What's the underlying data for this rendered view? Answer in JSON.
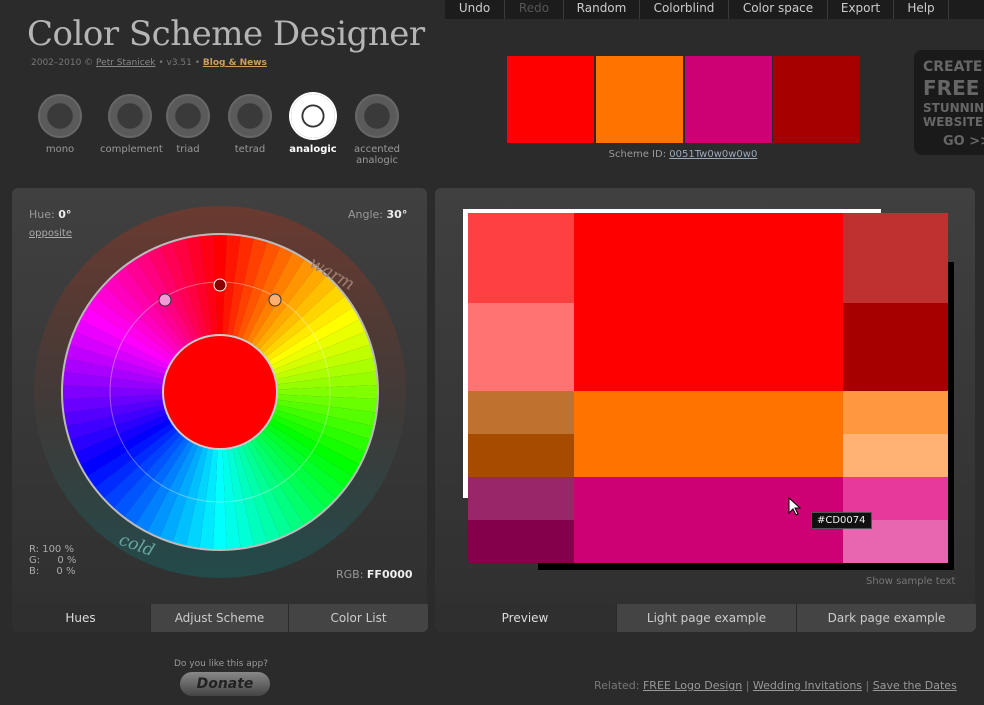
{
  "app": {
    "title": "Color Scheme Designer",
    "subline_prefix": "2002–2010 ©",
    "author": "Petr Stanicek",
    "version": "• v3.51 •",
    "blog": "Blog & News"
  },
  "menu": [
    {
      "label": "Undo",
      "enabled": true
    },
    {
      "label": "Redo",
      "enabled": false
    },
    {
      "label": "Random",
      "enabled": true
    },
    {
      "label": "Colorblind",
      "enabled": true
    },
    {
      "label": "Color space",
      "enabled": true
    },
    {
      "label": "Export",
      "enabled": true
    },
    {
      "label": "Help",
      "enabled": true
    }
  ],
  "scheme_types": [
    "mono",
    "complement",
    "triad",
    "tetrad",
    "analogic",
    "accented analogic"
  ],
  "selected_scheme_type": "analogic",
  "swatches": [
    "#FF0000",
    "#FF7400",
    "#CD0074",
    "#A60000"
  ],
  "scheme": {
    "label": "Scheme ID:",
    "id": "0051Tw0w0w0w0"
  },
  "ad": {
    "line1": "CREATE",
    "line2": "FREE",
    "line3": "STUNNING",
    "line4": "WEBSITES",
    "cta": "GO >>"
  },
  "left_panel": {
    "hue_label": "Hue:",
    "hue_value": "0°",
    "opposite": "opposite",
    "angle_label": "Angle:",
    "angle_value": "30°",
    "warm": "warm",
    "cold": "cold",
    "r_label": "R:",
    "r_value": "100 %",
    "g_label": "G:",
    "g_value": "0 %",
    "b_label": "B:",
    "b_value": "0 %",
    "rgb_label": "RGB:",
    "rgb_value": "FF0000",
    "tabs": [
      "Hues",
      "Adjust Scheme",
      "Color List"
    ],
    "selected_tab": "Hues"
  },
  "right_panel": {
    "tooltip": "#CD0074",
    "show_sample": "Show sample text",
    "tabs": [
      "Preview",
      "Light page example",
      "Dark page example"
    ],
    "selected_tab": "Preview"
  },
  "footer": {
    "like": "Do you like this app?",
    "donate": "Donate",
    "related_label": "Related:",
    "links": [
      "FREE Logo Design",
      "Wedding Invitations",
      "Save the Dates"
    ]
  }
}
